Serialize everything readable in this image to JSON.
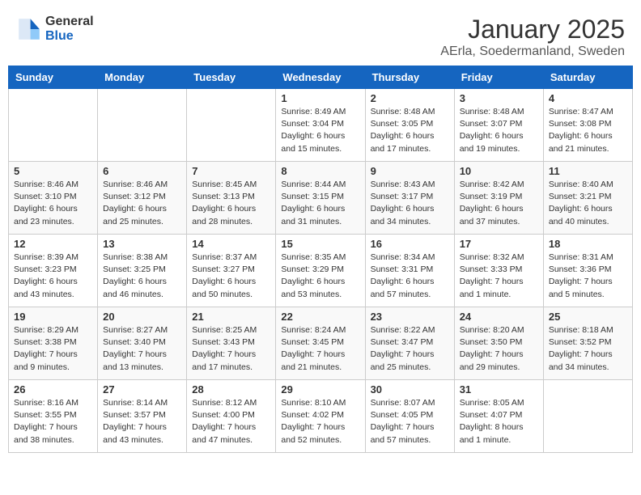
{
  "header": {
    "logo": {
      "general": "General",
      "blue": "Blue"
    },
    "title": "January 2025",
    "location": "AErla, Soedermanland, Sweden"
  },
  "weekdays": [
    "Sunday",
    "Monday",
    "Tuesday",
    "Wednesday",
    "Thursday",
    "Friday",
    "Saturday"
  ],
  "weeks": [
    [
      {
        "day": null,
        "info": null
      },
      {
        "day": null,
        "info": null
      },
      {
        "day": null,
        "info": null
      },
      {
        "day": "1",
        "info": "Sunrise: 8:49 AM\nSunset: 3:04 PM\nDaylight: 6 hours\nand 15 minutes."
      },
      {
        "day": "2",
        "info": "Sunrise: 8:48 AM\nSunset: 3:05 PM\nDaylight: 6 hours\nand 17 minutes."
      },
      {
        "day": "3",
        "info": "Sunrise: 8:48 AM\nSunset: 3:07 PM\nDaylight: 6 hours\nand 19 minutes."
      },
      {
        "day": "4",
        "info": "Sunrise: 8:47 AM\nSunset: 3:08 PM\nDaylight: 6 hours\nand 21 minutes."
      }
    ],
    [
      {
        "day": "5",
        "info": "Sunrise: 8:46 AM\nSunset: 3:10 PM\nDaylight: 6 hours\nand 23 minutes."
      },
      {
        "day": "6",
        "info": "Sunrise: 8:46 AM\nSunset: 3:12 PM\nDaylight: 6 hours\nand 25 minutes."
      },
      {
        "day": "7",
        "info": "Sunrise: 8:45 AM\nSunset: 3:13 PM\nDaylight: 6 hours\nand 28 minutes."
      },
      {
        "day": "8",
        "info": "Sunrise: 8:44 AM\nSunset: 3:15 PM\nDaylight: 6 hours\nand 31 minutes."
      },
      {
        "day": "9",
        "info": "Sunrise: 8:43 AM\nSunset: 3:17 PM\nDaylight: 6 hours\nand 34 minutes."
      },
      {
        "day": "10",
        "info": "Sunrise: 8:42 AM\nSunset: 3:19 PM\nDaylight: 6 hours\nand 37 minutes."
      },
      {
        "day": "11",
        "info": "Sunrise: 8:40 AM\nSunset: 3:21 PM\nDaylight: 6 hours\nand 40 minutes."
      }
    ],
    [
      {
        "day": "12",
        "info": "Sunrise: 8:39 AM\nSunset: 3:23 PM\nDaylight: 6 hours\nand 43 minutes."
      },
      {
        "day": "13",
        "info": "Sunrise: 8:38 AM\nSunset: 3:25 PM\nDaylight: 6 hours\nand 46 minutes."
      },
      {
        "day": "14",
        "info": "Sunrise: 8:37 AM\nSunset: 3:27 PM\nDaylight: 6 hours\nand 50 minutes."
      },
      {
        "day": "15",
        "info": "Sunrise: 8:35 AM\nSunset: 3:29 PM\nDaylight: 6 hours\nand 53 minutes."
      },
      {
        "day": "16",
        "info": "Sunrise: 8:34 AM\nSunset: 3:31 PM\nDaylight: 6 hours\nand 57 minutes."
      },
      {
        "day": "17",
        "info": "Sunrise: 8:32 AM\nSunset: 3:33 PM\nDaylight: 7 hours\nand 1 minute."
      },
      {
        "day": "18",
        "info": "Sunrise: 8:31 AM\nSunset: 3:36 PM\nDaylight: 7 hours\nand 5 minutes."
      }
    ],
    [
      {
        "day": "19",
        "info": "Sunrise: 8:29 AM\nSunset: 3:38 PM\nDaylight: 7 hours\nand 9 minutes."
      },
      {
        "day": "20",
        "info": "Sunrise: 8:27 AM\nSunset: 3:40 PM\nDaylight: 7 hours\nand 13 minutes."
      },
      {
        "day": "21",
        "info": "Sunrise: 8:25 AM\nSunset: 3:43 PM\nDaylight: 7 hours\nand 17 minutes."
      },
      {
        "day": "22",
        "info": "Sunrise: 8:24 AM\nSunset: 3:45 PM\nDaylight: 7 hours\nand 21 minutes."
      },
      {
        "day": "23",
        "info": "Sunrise: 8:22 AM\nSunset: 3:47 PM\nDaylight: 7 hours\nand 25 minutes."
      },
      {
        "day": "24",
        "info": "Sunrise: 8:20 AM\nSunset: 3:50 PM\nDaylight: 7 hours\nand 29 minutes."
      },
      {
        "day": "25",
        "info": "Sunrise: 8:18 AM\nSunset: 3:52 PM\nDaylight: 7 hours\nand 34 minutes."
      }
    ],
    [
      {
        "day": "26",
        "info": "Sunrise: 8:16 AM\nSunset: 3:55 PM\nDaylight: 7 hours\nand 38 minutes."
      },
      {
        "day": "27",
        "info": "Sunrise: 8:14 AM\nSunset: 3:57 PM\nDaylight: 7 hours\nand 43 minutes."
      },
      {
        "day": "28",
        "info": "Sunrise: 8:12 AM\nSunset: 4:00 PM\nDaylight: 7 hours\nand 47 minutes."
      },
      {
        "day": "29",
        "info": "Sunrise: 8:10 AM\nSunset: 4:02 PM\nDaylight: 7 hours\nand 52 minutes."
      },
      {
        "day": "30",
        "info": "Sunrise: 8:07 AM\nSunset: 4:05 PM\nDaylight: 7 hours\nand 57 minutes."
      },
      {
        "day": "31",
        "info": "Sunrise: 8:05 AM\nSunset: 4:07 PM\nDaylight: 8 hours\nand 1 minute."
      },
      {
        "day": null,
        "info": null
      }
    ]
  ]
}
